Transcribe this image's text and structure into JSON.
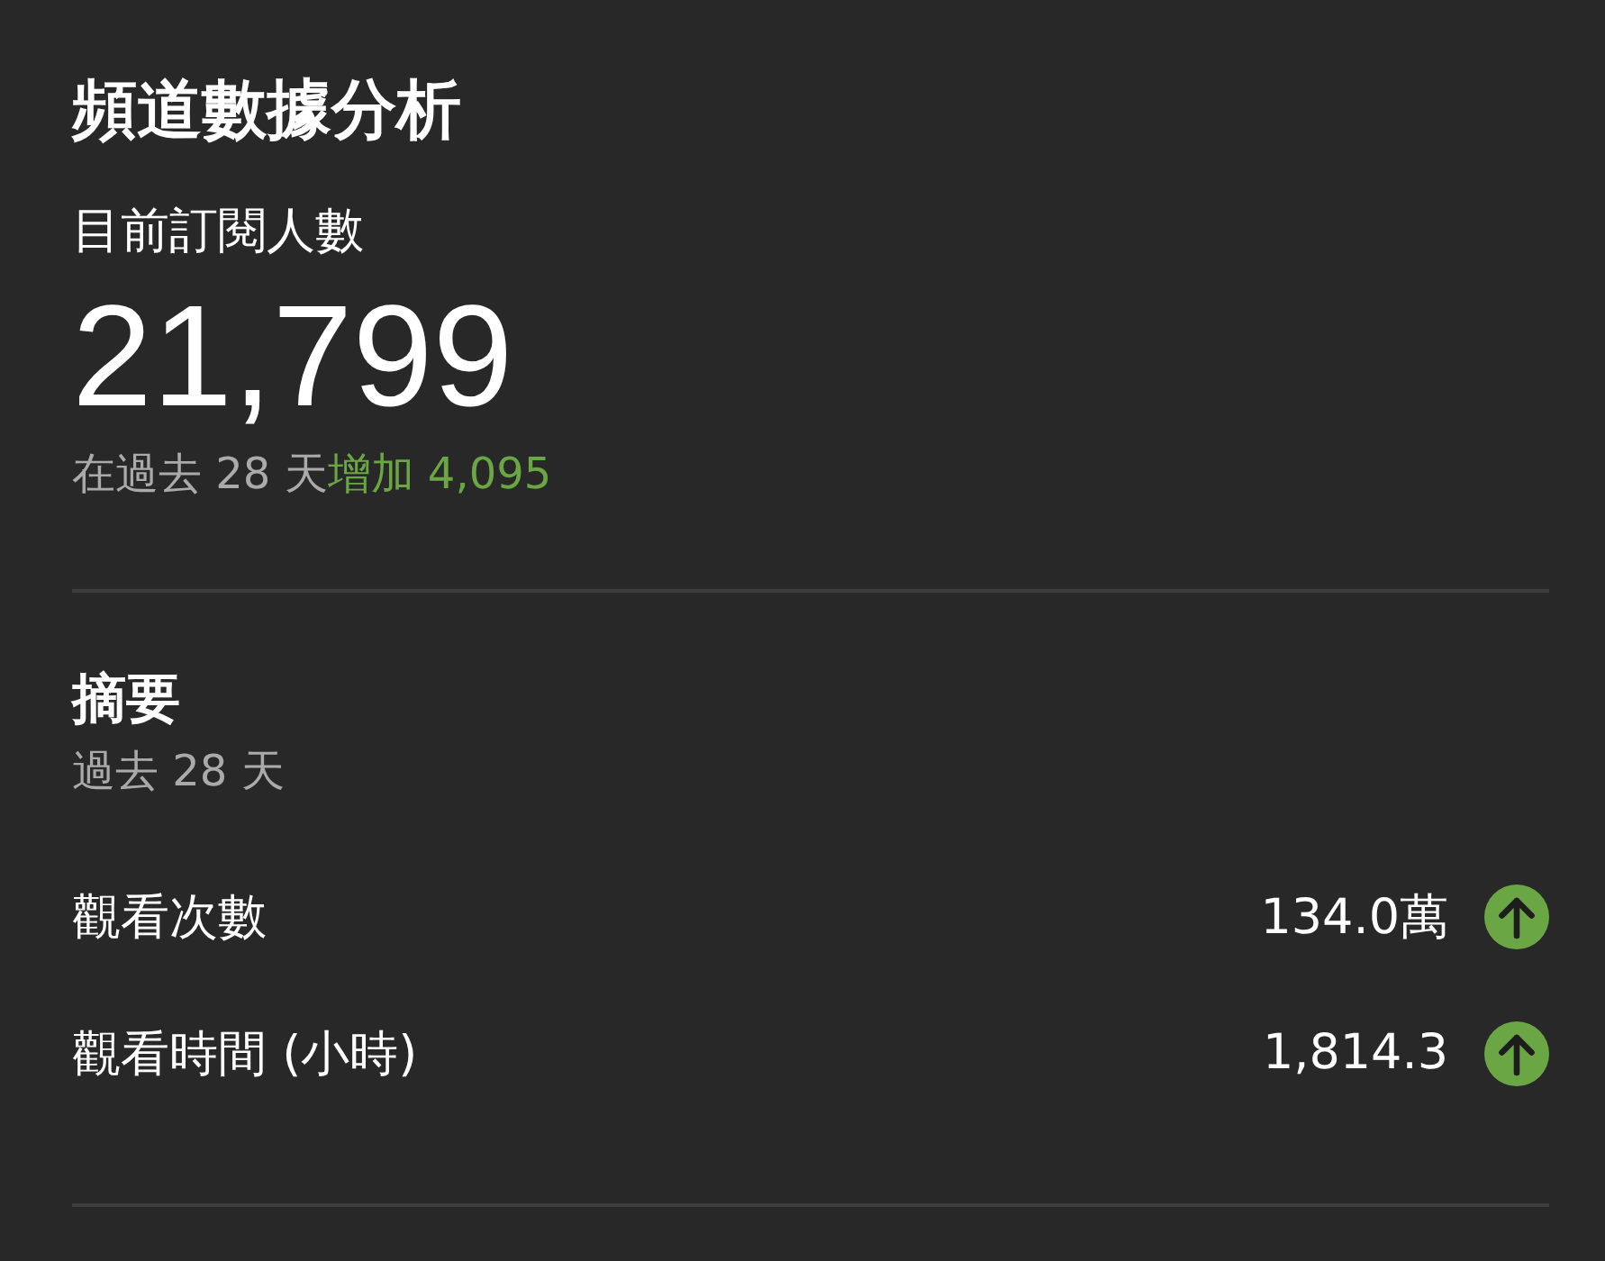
{
  "title": "頻道數據分析",
  "subscribers": {
    "label": "目前訂閱人數",
    "value": "21,799",
    "change_prefix": "在過去 28 天",
    "change_highlight": "增加 4,095"
  },
  "summary": {
    "title": "摘要",
    "period": "過去 28 天",
    "metrics": [
      {
        "name": "觀看次數",
        "value": "134.0萬",
        "increased": true
      },
      {
        "name": "觀看時間 (小時)",
        "value": "1,814.3",
        "increased": true
      }
    ]
  }
}
